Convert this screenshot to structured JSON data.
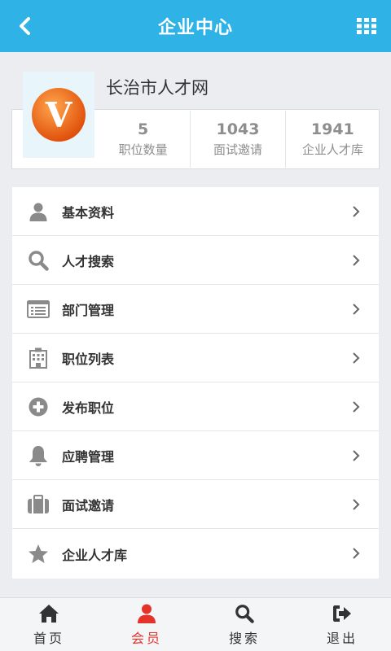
{
  "header": {
    "title": "企业中心"
  },
  "company": {
    "name": "长治市人才网",
    "logo_letter": "V"
  },
  "stats": [
    {
      "value": "5",
      "label": "职位数量"
    },
    {
      "value": "1043",
      "label": "面试邀请"
    },
    {
      "value": "1941",
      "label": "企业人才库"
    }
  ],
  "menu": [
    {
      "label": "基本资料",
      "icon": "user-icon"
    },
    {
      "label": "人才搜索",
      "icon": "search-icon"
    },
    {
      "label": "部门管理",
      "icon": "list-icon"
    },
    {
      "label": "职位列表",
      "icon": "building-icon"
    },
    {
      "label": "发布职位",
      "icon": "plus-circle-icon"
    },
    {
      "label": "应聘管理",
      "icon": "bell-icon"
    },
    {
      "label": "面试邀请",
      "icon": "briefcase-icon"
    },
    {
      "label": "企业人才库",
      "icon": "star-icon"
    }
  ],
  "tabs": [
    {
      "label": "首页",
      "icon": "home-icon"
    },
    {
      "label": "会员",
      "icon": "member-icon",
      "active": true
    },
    {
      "label": "搜索",
      "icon": "search-icon"
    },
    {
      "label": "退出",
      "icon": "logout-icon"
    }
  ],
  "colors": {
    "header": "#2fb3e6",
    "accent_active": "#e5332a",
    "logo_orange": "#f07a1a",
    "icon_gray": "#8a8a8a"
  }
}
